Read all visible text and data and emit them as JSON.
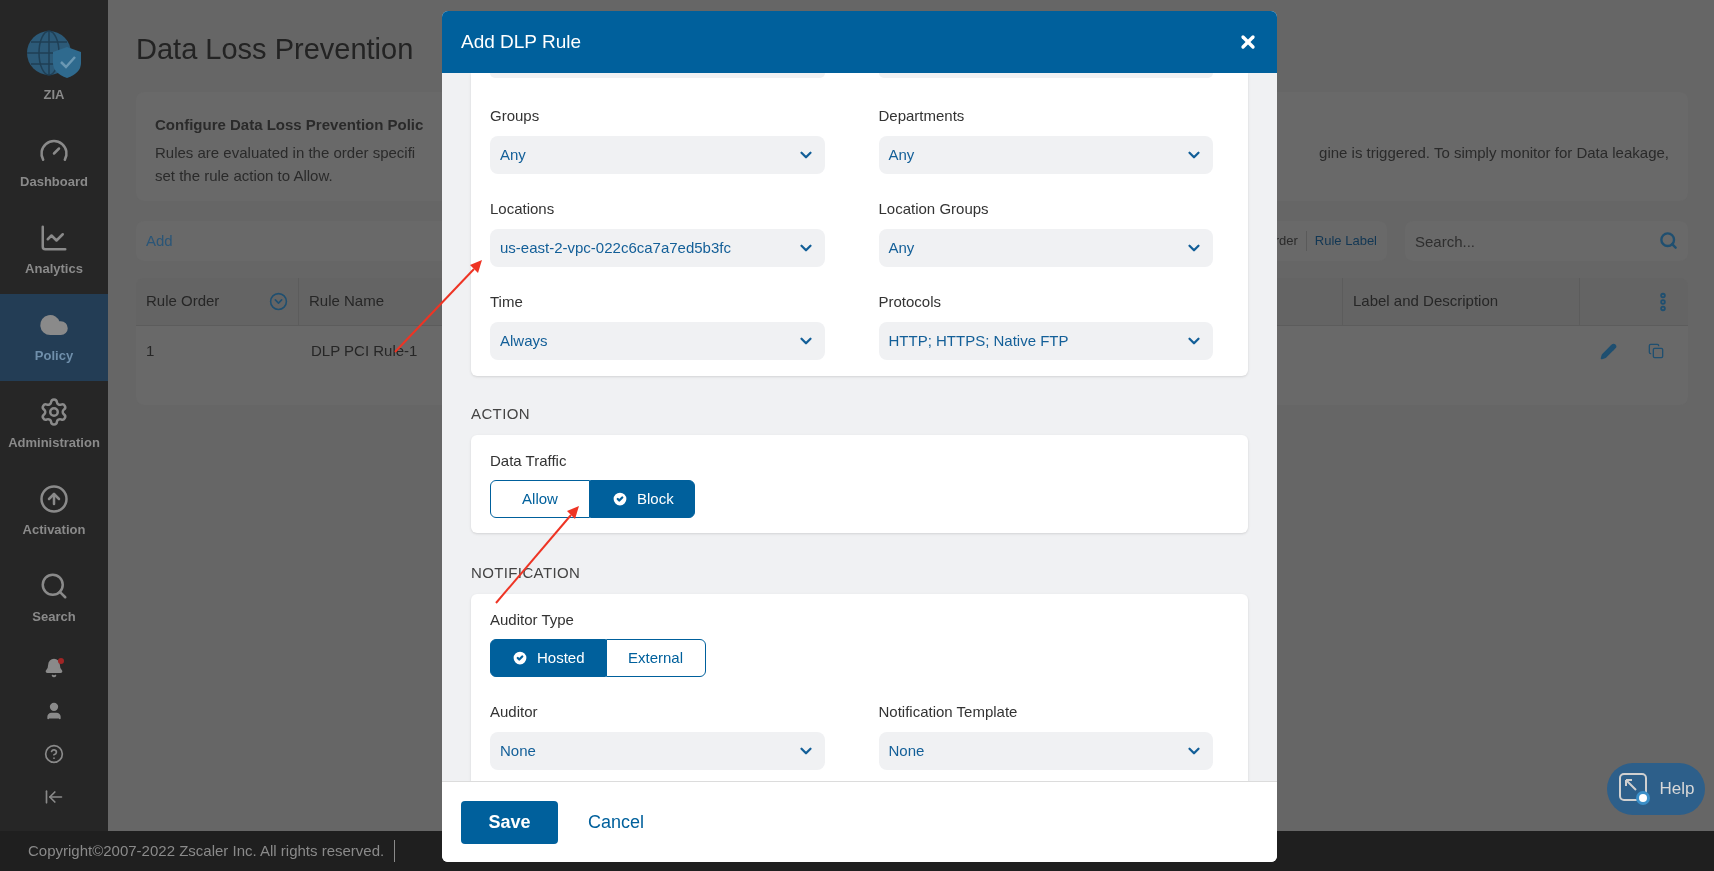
{
  "sidebar": {
    "items": [
      {
        "kind": "zia",
        "label": "ZIA",
        "selected": false
      },
      {
        "kind": "dashboard",
        "label": "Dashboard",
        "selected": false
      },
      {
        "kind": "analytics",
        "label": "Analytics",
        "selected": false
      },
      {
        "kind": "policy",
        "label": "Policy",
        "selected": true
      },
      {
        "kind": "administration",
        "label": "Administration",
        "selected": false
      },
      {
        "kind": "activation",
        "label": "Activation",
        "selected": false
      },
      {
        "kind": "search",
        "label": "Search",
        "selected": false
      }
    ],
    "icons": [
      {
        "kind": "alerts",
        "badge": true
      },
      {
        "kind": "user"
      },
      {
        "kind": "help"
      },
      {
        "kind": "collapse"
      }
    ]
  },
  "page": {
    "title": "Data Loss Prevention",
    "info": {
      "heading": "Configure Data Loss Prevention Polic",
      "line_left": "Rules are evaluated in the order specifi",
      "line_right": "gine is triggered. To simply monitor for Data leakage,",
      "line_2": "set the rule action to Allow."
    },
    "toolbar": {
      "add": "Add",
      "sort_partial": "rder",
      "rule_label": "Rule Label",
      "search_placeholder": "Search..."
    },
    "table": {
      "columns": [
        "Rule Order",
        "Rule Name",
        "Label and Description"
      ],
      "rows": [
        {
          "order": "1",
          "name": "DLP PCI Rule-1"
        }
      ]
    }
  },
  "modal": {
    "title": "Add DLP Rule",
    "fields": [
      {
        "label": "Groups",
        "value": "Any"
      },
      {
        "label": "Departments",
        "value": "Any"
      },
      {
        "label": "Locations",
        "value": "us-east-2-vpc-022c6ca7a7ed5b3fc"
      },
      {
        "label": "Location Groups",
        "value": "Any"
      },
      {
        "label": "Time",
        "value": "Always"
      },
      {
        "label": "Protocols",
        "value": "HTTP; HTTPS; Native FTP"
      }
    ],
    "action": {
      "section": "ACTION",
      "label": "Data Traffic",
      "options": [
        {
          "label": "Allow",
          "selected": false
        },
        {
          "label": "Block",
          "selected": true
        }
      ]
    },
    "notification": {
      "section": "NOTIFICATION",
      "label": "Auditor Type",
      "options": [
        {
          "label": "Hosted",
          "selected": true
        },
        {
          "label": "External",
          "selected": false
        }
      ],
      "fields": [
        {
          "label": "Auditor",
          "value": "None"
        },
        {
          "label": "Notification Template",
          "value": "None"
        }
      ]
    },
    "buttons": {
      "save": "Save",
      "cancel": "Cancel"
    }
  },
  "help": {
    "label": "Help"
  },
  "footer": {
    "copyright": "Copyright©2007-2022 Zscaler Inc. All rights reserved."
  }
}
